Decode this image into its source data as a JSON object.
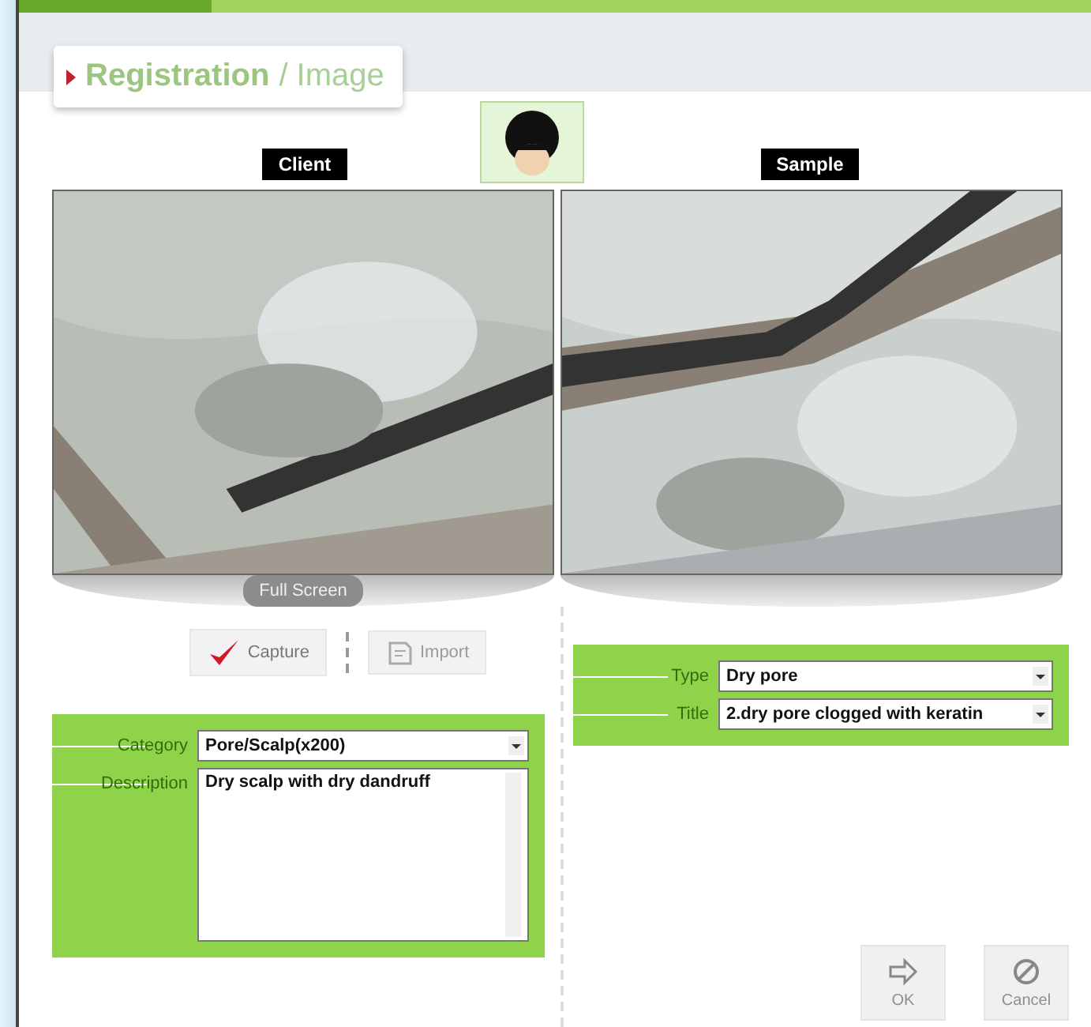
{
  "header": {
    "title": "Registration",
    "subtitle": "/ Image"
  },
  "viewers": [
    {
      "label": "Client"
    },
    {
      "label": "Sample"
    }
  ],
  "full_screen": {
    "label": "Full Screen"
  },
  "actions": [
    {
      "label": "Capture",
      "kind": "capture",
      "disabled": false
    },
    {
      "label": "Import",
      "kind": "import",
      "disabled": true
    }
  ],
  "client_form": {
    "fields": [
      {
        "label": "Category",
        "kind": "select",
        "value": "Pore/Scalp(x200)"
      },
      {
        "label": "Description",
        "kind": "textarea",
        "value": "Dry scalp with dry dandruff"
      }
    ]
  },
  "sample_form": {
    "fields": [
      {
        "label": "Type",
        "kind": "select",
        "value": "Dry pore"
      },
      {
        "label": "Title",
        "kind": "select",
        "value": "2.dry pore clogged with keratin"
      }
    ]
  },
  "buttons": [
    {
      "label": "OK",
      "kind": "ok",
      "disabled": true
    },
    {
      "label": "Cancel",
      "kind": "cancel",
      "disabled": true
    }
  ]
}
